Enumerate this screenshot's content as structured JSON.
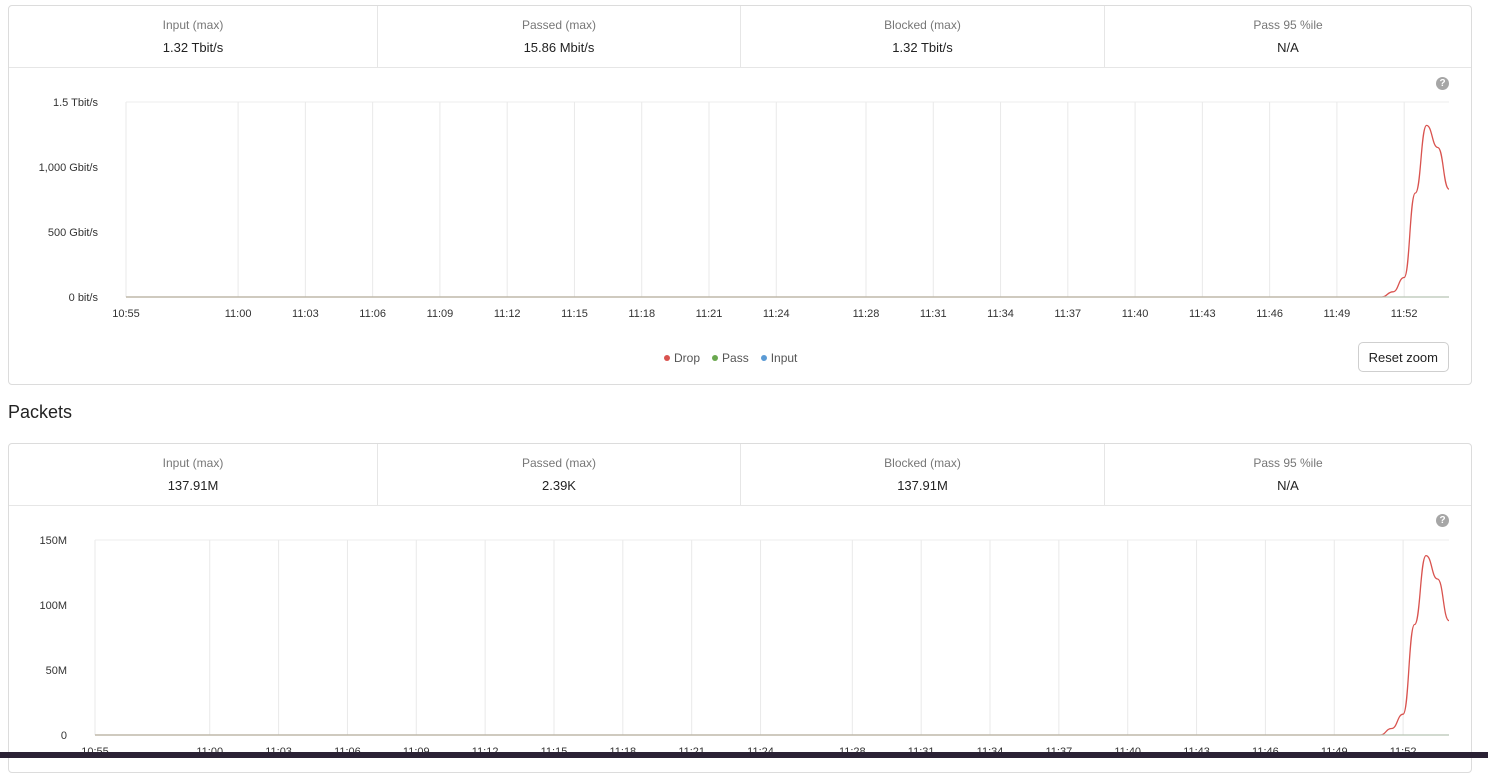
{
  "bandwidth": {
    "stats": [
      {
        "label": "Input (max)",
        "value": "1.32 Tbit/s"
      },
      {
        "label": "Passed (max)",
        "value": "15.86 Mbit/s"
      },
      {
        "label": "Blocked (max)",
        "value": "1.32 Tbit/s"
      },
      {
        "label": "Pass 95 %ile",
        "value": "N/A"
      }
    ],
    "help_icon": "?",
    "legend": [
      {
        "name": "Drop",
        "color": "#d9534f"
      },
      {
        "name": "Pass",
        "color": "#6aa84f"
      },
      {
        "name": "Input",
        "color": "#5b9bd5"
      }
    ],
    "reset_zoom_label": "Reset zoom"
  },
  "packets": {
    "title": "Packets",
    "stats": [
      {
        "label": "Input (max)",
        "value": "137.91M"
      },
      {
        "label": "Passed (max)",
        "value": "2.39K"
      },
      {
        "label": "Blocked (max)",
        "value": "137.91M"
      },
      {
        "label": "Pass 95 %ile",
        "value": "N/A"
      }
    ],
    "help_icon": "?"
  },
  "chart_data": [
    {
      "type": "line",
      "y_ticks": [
        "0 bit/s",
        "500 Gbit/s",
        "1,000 Gbit/s",
        "1.5 Tbit/s"
      ],
      "y_tick_values": [
        0,
        500,
        1000,
        1500
      ],
      "ylim": [
        0,
        1500
      ],
      "y_unit": "Gbit/s",
      "x_ticks": [
        "10:55",
        "11:00",
        "11:03",
        "11:06",
        "11:09",
        "11:12",
        "11:15",
        "11:18",
        "11:21",
        "11:24",
        "11:28",
        "11:31",
        "11:34",
        "11:37",
        "11:40",
        "11:43",
        "11:46",
        "11:49",
        "11:52"
      ],
      "xlim": [
        "10:55",
        "11:54"
      ],
      "grid": true,
      "legend_position": "bottom-center",
      "series": [
        {
          "name": "Drop",
          "color": "#d9534f",
          "x": [
            "10:55",
            "11:51",
            "11:51.5",
            "11:52",
            "11:52.5",
            "11:53",
            "11:53.5",
            "11:54"
          ],
          "y": [
            0,
            0,
            40,
            150,
            800,
            1320,
            1150,
            830
          ]
        },
        {
          "name": "Pass",
          "color": "#6aa84f",
          "x": [
            "10:55",
            "11:54"
          ],
          "y": [
            0,
            0
          ]
        },
        {
          "name": "Input",
          "color": "#5b9bd5",
          "x": [],
          "y": []
        }
      ]
    },
    {
      "type": "line",
      "y_ticks": [
        "0",
        "50M",
        "100M",
        "150M"
      ],
      "y_tick_values": [
        0,
        50,
        100,
        150
      ],
      "ylim": [
        0,
        150
      ],
      "y_unit": "M",
      "x_ticks": [
        "10:55",
        "11:00",
        "11:03",
        "11:06",
        "11:09",
        "11:12",
        "11:15",
        "11:18",
        "11:21",
        "11:24",
        "11:28",
        "11:31",
        "11:34",
        "11:37",
        "11:40",
        "11:43",
        "11:46",
        "11:49",
        "11:52"
      ],
      "xlim": [
        "10:55",
        "11:54"
      ],
      "grid": true,
      "series": [
        {
          "name": "Drop",
          "color": "#d9534f",
          "x": [
            "10:55",
            "11:51",
            "11:51.5",
            "11:52",
            "11:52.5",
            "11:53",
            "11:53.5",
            "11:54"
          ],
          "y": [
            0,
            0,
            5,
            16,
            85,
            138,
            120,
            88
          ]
        },
        {
          "name": "Pass",
          "color": "#6aa84f",
          "x": [
            "10:55",
            "11:54"
          ],
          "y": [
            0,
            0
          ]
        }
      ]
    }
  ]
}
